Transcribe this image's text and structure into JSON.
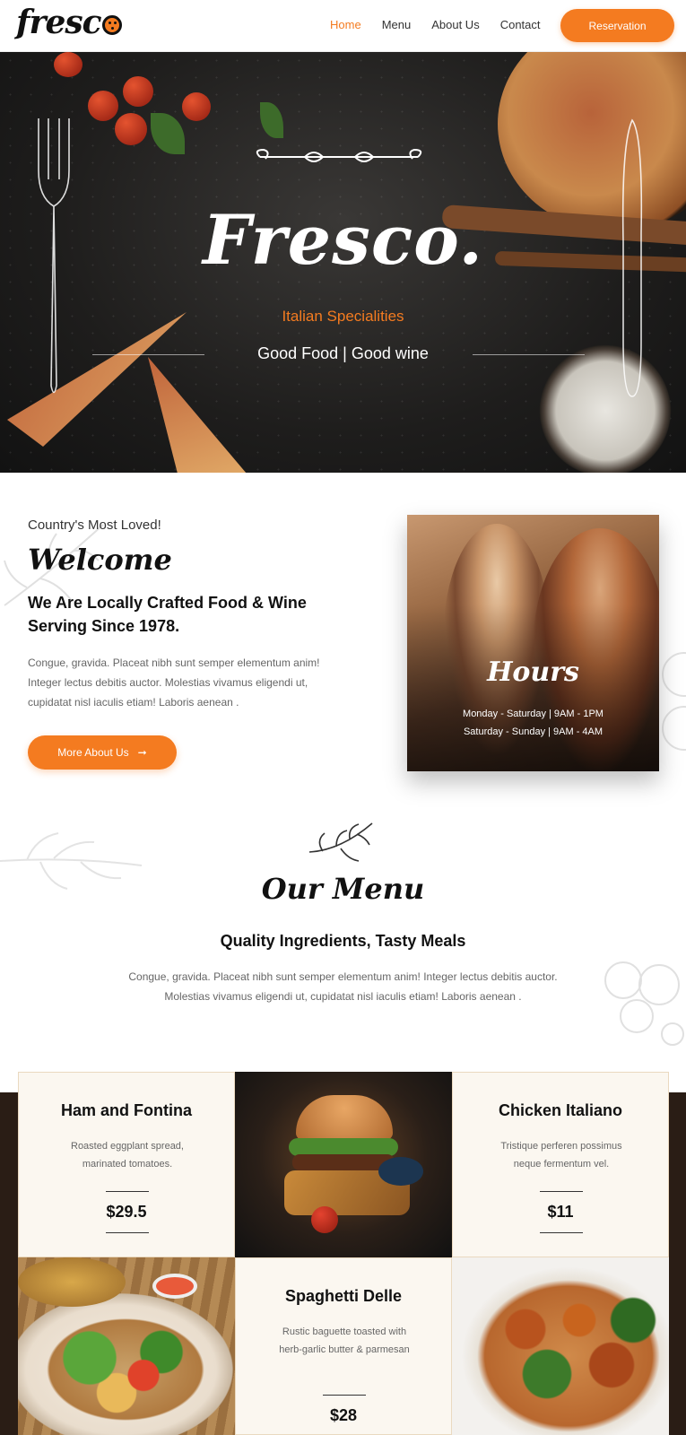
{
  "header": {
    "logo": "fresc",
    "nav": [
      "Home",
      "Menu",
      "About Us",
      "Contact"
    ],
    "cta": "Reservation"
  },
  "hero": {
    "title": "Fresco.",
    "subtitle": "Italian Specialities",
    "tagline": "Good Food | Good wine"
  },
  "welcome": {
    "kicker": "Country's Most Loved!",
    "title": "Welcome",
    "heading": "We Are Locally Crafted Food & Wine Serving Since 1978.",
    "body": "Congue, gravida. Placeat nibh sunt semper elementum anim! Integer lectus debitis auctor. Molestias vivamus eligendi ut, cupidatat nisl iaculis etiam! Laboris aenean .",
    "button": "More About Us"
  },
  "hours": {
    "title": "Hours",
    "lines": [
      "Monday - Saturday | 9AM - 1PM",
      "Saturday - Sunday | 9AM - 4AM"
    ]
  },
  "menu": {
    "title": "Our Menu",
    "heading": "Quality Ingredients, Tasty Meals",
    "body": "Congue, gravida. Placeat nibh sunt semper elementum anim! Integer lectus debitis auctor. Molestias vivamus eligendi ut, cupidatat nisl iaculis etiam! Laboris aenean .",
    "items": [
      {
        "name": "Ham and Fontina",
        "desc": "Roasted eggplant spread, marinated tomatoes.",
        "price": "$29.5"
      },
      {
        "name": "Chicken Italiano",
        "desc": "Tristique perferen possimus neque fermentum vel.",
        "price": "$11"
      },
      {
        "name": "Spaghetti Delle",
        "desc": "Rustic baguette toasted with herb-garlic butter & parmesan",
        "price": "$28"
      }
    ]
  },
  "colors": {
    "accent": "#f47b20"
  }
}
